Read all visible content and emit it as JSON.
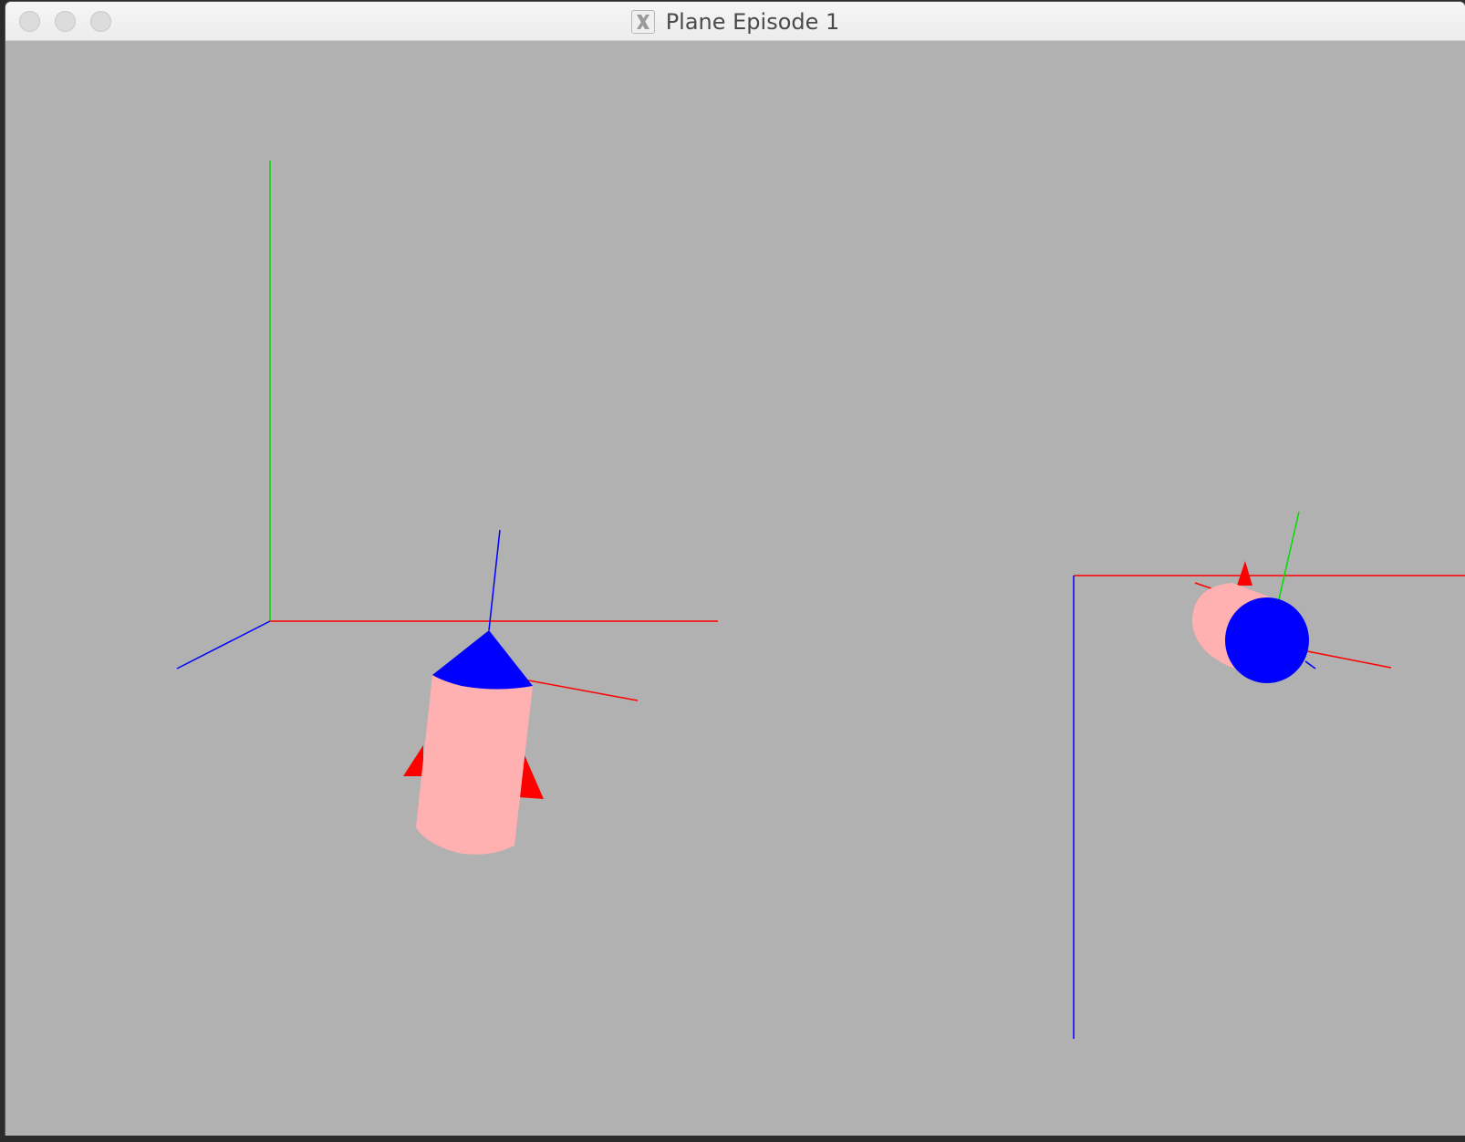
{
  "window": {
    "title": "Plane Episode 1",
    "app_icon": "x11-icon"
  },
  "titlebar_buttons": [
    "close",
    "minimize",
    "zoom"
  ],
  "scene": {
    "background_color": "#b1b1b1",
    "axis_colors": {
      "x": "#ff0000",
      "y": "#00dd00",
      "z": "#0000ff"
    },
    "body_color": "#ffb0b0",
    "nose_color": "#0000ff",
    "fin_color": "#ff0000",
    "objects": [
      "world-axes",
      "rocket-1",
      "rocket-2-axes",
      "rocket-2"
    ]
  }
}
